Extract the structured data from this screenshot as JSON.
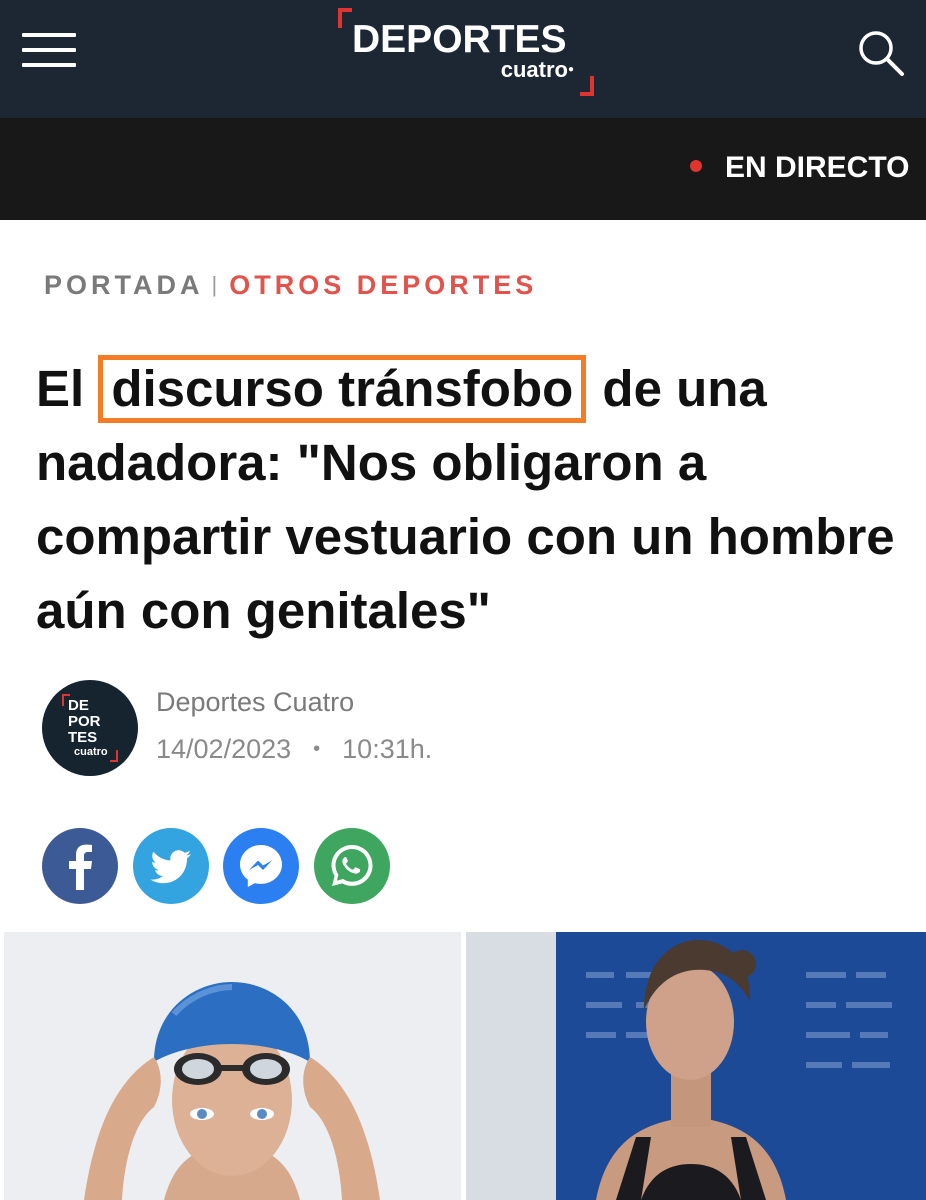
{
  "header": {
    "brand_main": "DEPORTES",
    "brand_sub": "cuatro",
    "menu_icon": "hamburger-icon",
    "search_icon": "search-icon"
  },
  "live": {
    "label": "EN DIRECTO",
    "dot_color": "#e2342f"
  },
  "breadcrumb": {
    "home": "PORTADA",
    "separator": "|",
    "section": "OTROS DEPORTES"
  },
  "article": {
    "title_before": "El ",
    "title_highlight": "discurso tránsfobo",
    "title_after": " de una nadadora: \"Nos obligaron a compartir vestuario con un hombre aún con genitales\"",
    "highlight_color": "#f47c27",
    "author": "Deportes Cuatro",
    "avatar_lines": [
      "DE",
      "POR",
      "TES"
    ],
    "avatar_sub": "cuatro",
    "date": "14/02/2023",
    "meta_separator": "•",
    "time": "10:31h."
  },
  "share": [
    {
      "network": "facebook",
      "icon": "facebook-icon",
      "color": "#3c5a96"
    },
    {
      "network": "twitter",
      "icon": "twitter-icon",
      "color": "#34a4e0"
    },
    {
      "network": "messenger",
      "icon": "messenger-icon",
      "color": "#2c7ff0"
    },
    {
      "network": "whatsapp",
      "icon": "whatsapp-icon",
      "color": "#3fa660"
    }
  ],
  "colors": {
    "header_bg": "#1c2733",
    "live_bar_bg": "#181818",
    "accent_red": "#e2342f",
    "section_red": "#e2534b"
  }
}
